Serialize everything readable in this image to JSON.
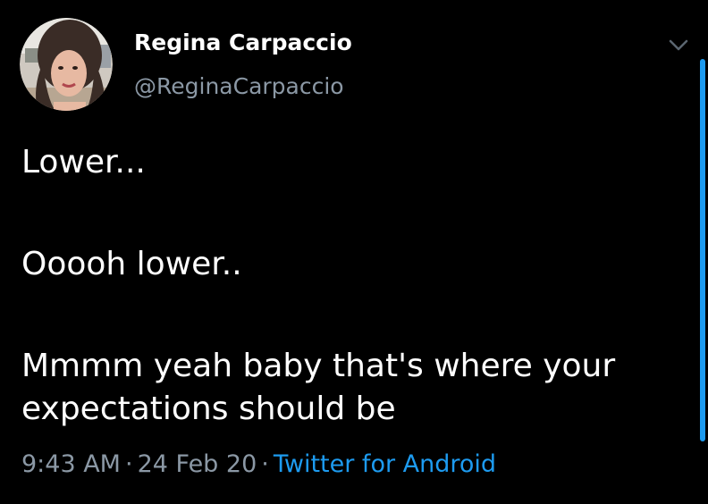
{
  "author": {
    "display_name": "Regina Carpaccio",
    "handle": "@ReginaCarpaccio"
  },
  "tweet": {
    "paragraphs": [
      "Lower...",
      "Ooooh lower..",
      "Mmmm yeah baby that's where your expectations should be"
    ]
  },
  "meta": {
    "time": "9:43 AM",
    "date": "24 Feb 20",
    "separator": "·",
    "source": "Twitter for Android"
  },
  "icons": {
    "chevron": "chevron-down-icon",
    "avatar": "user-avatar"
  },
  "colors": {
    "background": "#000000",
    "text_primary": "#ffffff",
    "text_secondary": "#8b98a5",
    "link": "#1d9bf0",
    "scrollbar": "#1d9bf0"
  }
}
